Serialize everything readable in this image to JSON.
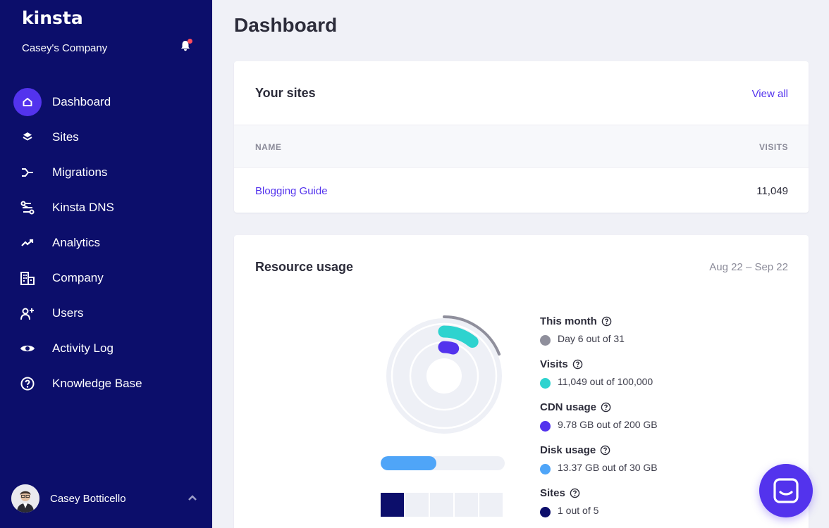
{
  "sidebar": {
    "brand": "kinsta",
    "company": "Casey's Company",
    "notification_icon": "bell-icon",
    "items": [
      {
        "label": "Dashboard",
        "icon": "home-icon",
        "active": true
      },
      {
        "label": "Sites",
        "icon": "layers-icon"
      },
      {
        "label": "Migrations",
        "icon": "migration-icon"
      },
      {
        "label": "Kinsta DNS",
        "icon": "dns-icon"
      },
      {
        "label": "Analytics",
        "icon": "trend-icon"
      },
      {
        "label": "Company",
        "icon": "building-icon"
      },
      {
        "label": "Users",
        "icon": "add-user-icon"
      },
      {
        "label": "Activity Log",
        "icon": "eye-icon"
      },
      {
        "label": "Knowledge Base",
        "icon": "question-icon"
      }
    ],
    "user": {
      "name": "Casey Botticello"
    }
  },
  "main": {
    "title": "Dashboard",
    "sites_card": {
      "title": "Your sites",
      "view_all": "View all",
      "columns": {
        "name": "NAME",
        "visits": "VISITS"
      },
      "rows": [
        {
          "name": "Blogging Guide",
          "visits": "11,049"
        }
      ]
    },
    "usage_card": {
      "title": "Resource usage",
      "date_range": "Aug 22 – Sep 22",
      "legend": [
        {
          "title": "This month",
          "value": "Day 6 out of 31",
          "color": "#8f8f9c"
        },
        {
          "title": "Visits",
          "value": "11,049 out of 100,000",
          "color": "#2ed3cf"
        },
        {
          "title": "CDN usage",
          "value": "9.78 GB out of 200 GB",
          "color": "#5333ed"
        },
        {
          "title": "Disk usage",
          "value": "13.37 GB out of 30 GB",
          "color": "#4fa5f8"
        },
        {
          "title": "Sites",
          "value": "1 out of 5",
          "color": "#0c0e6b"
        }
      ],
      "gauge": {
        "month_fraction": 0.19,
        "visits_fraction": 0.11,
        "cdn_fraction": 0.05
      },
      "disk_fraction": 0.45,
      "sites_used": 1,
      "sites_total": 5
    }
  },
  "colors": {
    "sidebar": "#0c0e6b",
    "accent": "#5333ed",
    "background": "#f0f1f7"
  }
}
